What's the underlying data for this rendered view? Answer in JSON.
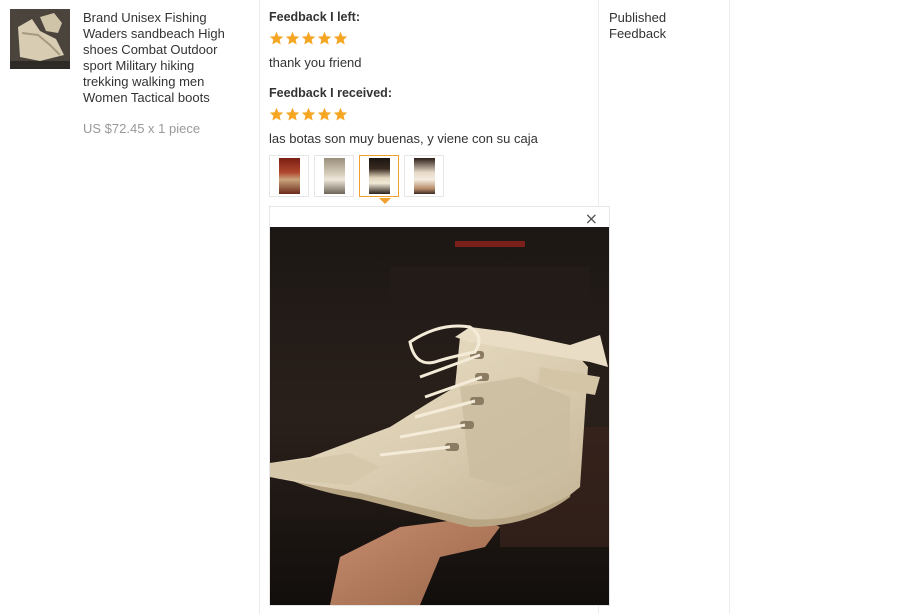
{
  "product": {
    "title_lines": [
      "Brand Unisex Fishing",
      "Waders sandbeach High",
      "shoes Combat Outdoor",
      "sport Military hiking",
      "trekking walking men",
      "Women Tactical boots"
    ],
    "price": "US $72.45 x 1 piece"
  },
  "feedback_left": {
    "heading": "Feedback I left:",
    "rating": 5,
    "text": "thank you friend"
  },
  "feedback_received": {
    "heading": "Feedback I received:",
    "rating": 5,
    "text": "las botas son muy buenas, y viene con su caja",
    "photos": [
      {
        "name": "photo-1",
        "selected": false
      },
      {
        "name": "photo-2",
        "selected": false
      },
      {
        "name": "photo-3",
        "selected": true
      },
      {
        "name": "photo-4",
        "selected": false
      }
    ]
  },
  "viewer": {
    "close_icon": "close-icon",
    "close_glyph": "×"
  },
  "status": {
    "lines": [
      "Published",
      "Feedback"
    ]
  },
  "colors": {
    "star": "#f5a623",
    "selected_border": "#f0a030",
    "price": "#999999"
  }
}
